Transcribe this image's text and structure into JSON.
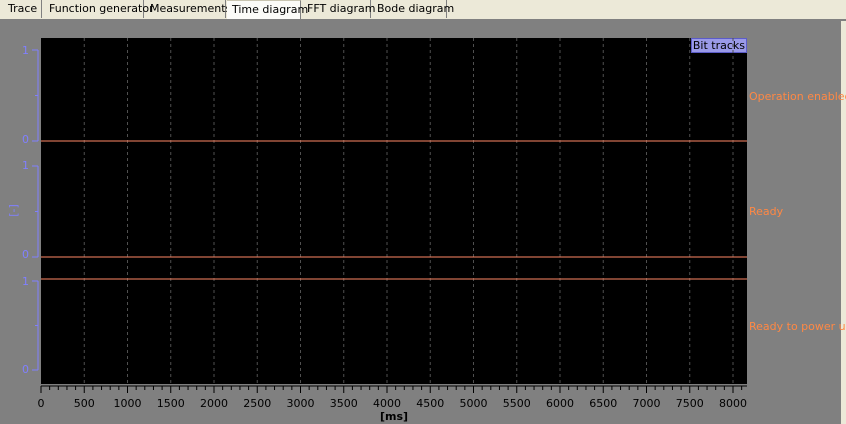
{
  "tabs": [
    {
      "label": "Trace",
      "active": false
    },
    {
      "label": "Function generator",
      "active": false
    },
    {
      "label": "Measurements",
      "active": false
    },
    {
      "label": "Time diagram",
      "active": true
    },
    {
      "label": "FFT diagram",
      "active": false
    },
    {
      "label": "Bode diagram",
      "active": false
    }
  ],
  "diagram": {
    "bit_tracks_label": "Bit tracks",
    "y_unit": "[-]",
    "x_unit": "[ms]",
    "x_ticks": [
      "0",
      "500",
      "1000",
      "1500",
      "2000",
      "2500",
      "3000",
      "3500",
      "4000",
      "4500",
      "5000",
      "5500",
      "6000",
      "6500",
      "7000",
      "7500",
      "8000"
    ],
    "x_range": [
      0,
      8100
    ],
    "tracks": [
      {
        "name": "Operation enabled",
        "y_top_label": "1",
        "y_bottom_label": "0",
        "value": 0
      },
      {
        "name": "Ready",
        "y_top_label": "1",
        "y_bottom_label": "0",
        "value": 0
      },
      {
        "name": "Ready to power up",
        "y_top_label": "1",
        "y_bottom_label": "0",
        "value": 1
      }
    ],
    "colors": {
      "plot_bg": "#000000",
      "signal": "#ff8866",
      "axis": "#8080ff",
      "grid": "#404040",
      "track_label": "#ff8844",
      "bit_tracks_bg": "#9a9ae8"
    }
  }
}
